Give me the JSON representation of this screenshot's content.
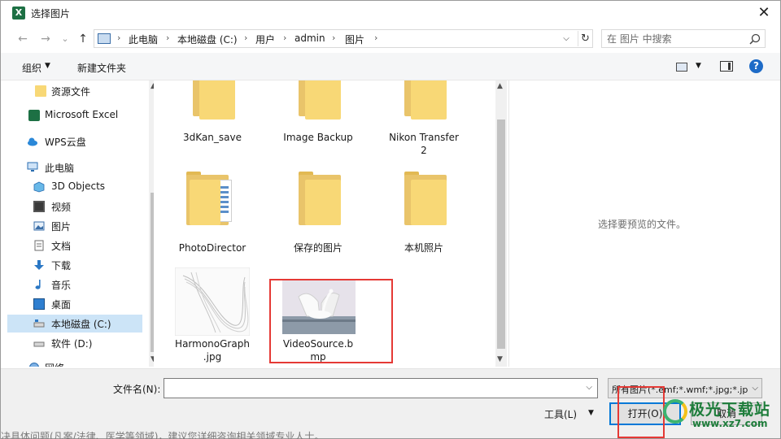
{
  "window": {
    "title": "选择图片",
    "app_icon_letter": "X",
    "close_glyph": "✕"
  },
  "nav": {
    "back_glyph": "←",
    "forward_glyph": "→",
    "recent_glyph": "⌄",
    "up_glyph": "↑",
    "breadcrumb": [
      "此电脑",
      "本地磁盘 (C:)",
      "用户",
      "admin",
      "图片"
    ],
    "crumb_sep": "›",
    "dropdown_glyph": "⌵",
    "refresh_glyph": "↻"
  },
  "search": {
    "placeholder": "在 图片 中搜索"
  },
  "toolbar": {
    "organize": "组织",
    "organize_arrow": "▼",
    "new_folder": "新建文件夹",
    "view_arrow": "▼",
    "help": "?"
  },
  "sidebar": {
    "items": [
      {
        "label": "资源文件",
        "icon": "folder-icon"
      },
      {
        "label": "Microsoft Excel",
        "icon": "excel-icon"
      },
      {
        "label": "WPS云盘",
        "icon": "cloud-icon"
      },
      {
        "label": "此电脑",
        "icon": "computer-icon"
      },
      {
        "label": "3D Objects",
        "icon": "cube-icon"
      },
      {
        "label": "视频",
        "icon": "video-icon"
      },
      {
        "label": "图片",
        "icon": "pictures-icon"
      },
      {
        "label": "文档",
        "icon": "document-icon"
      },
      {
        "label": "下载",
        "icon": "download-icon"
      },
      {
        "label": "音乐",
        "icon": "music-icon"
      },
      {
        "label": "桌面",
        "icon": "desktop-icon"
      },
      {
        "label": "本地磁盘 (C:)",
        "icon": "drive-icon",
        "selected": true
      },
      {
        "label": "软件 (D:)",
        "icon": "drive-icon"
      },
      {
        "label": "网络",
        "icon": "network-icon"
      }
    ],
    "scroll_up": "▲",
    "scroll_down": "▼"
  },
  "files": [
    {
      "name": "3dKan_save",
      "type": "folder"
    },
    {
      "name": "Image Backup",
      "type": "folder"
    },
    {
      "name": "Nikon Transfer 2",
      "type": "folder"
    },
    {
      "name": "PhotoDirector",
      "type": "folder"
    },
    {
      "name": "保存的图片",
      "type": "folder"
    },
    {
      "name": "本机照片",
      "type": "folder"
    },
    {
      "name": "HarmonoGraph.jpg",
      "type": "image"
    },
    {
      "name": "VideoSource.bmp",
      "type": "image",
      "highlighted": true
    }
  ],
  "file_labels": {
    "f0": "3dKan_save",
    "f1": "Image Backup",
    "f2a": "Nikon Transfer",
    "f2b": "2",
    "f3": "PhotoDirector",
    "f4": "保存的图片",
    "f5": "本机照片",
    "f6a": "HarmonoGraph",
    "f6b": ".jpg",
    "f7a": "VideoSource.b",
    "f7b": "mp"
  },
  "preview": {
    "empty_text": "选择要预览的文件。"
  },
  "footer": {
    "filename_label": "文件名(N):",
    "filename_value": "",
    "filter_selected": "所有图片(*.emf;*.wmf;*.jpg;*.jp",
    "tools": "工具(L)",
    "tools_arrow": "▼",
    "open": "打开(O)",
    "cancel": "取消",
    "combo_arrow": "⌵"
  },
  "watermark": {
    "cn": "极光下载站",
    "url": "www.xz7.com"
  },
  "background_text": "决具体问题(凡案/法律、医学等领域)，建议您详细咨询相关领域专业人士。",
  "colors": {
    "accent": "#0078d7",
    "highlight_box": "#e53935",
    "selected_nav": "#cce4f7",
    "folder": "#f8d876"
  }
}
